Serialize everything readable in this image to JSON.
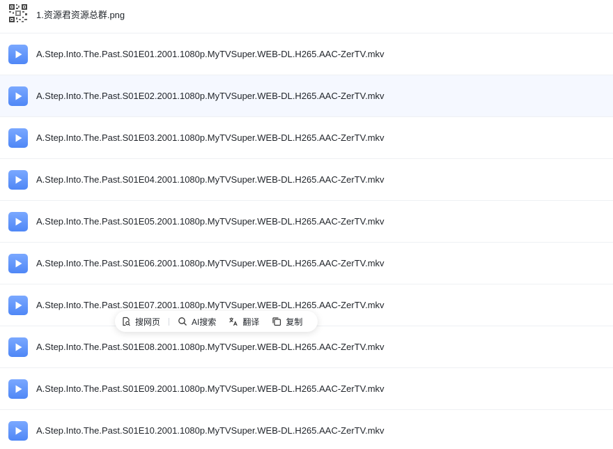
{
  "files": [
    {
      "name": "1.资源君资源总群.png",
      "icon": "qr-code-image-icon"
    },
    {
      "name": "A.Step.Into.The.Past.S01E01.2001.1080p.MyTVSuper.WEB-DL.H265.AAC-ZerTV.mkv",
      "icon": "video-play-icon"
    },
    {
      "name": "A.Step.Into.The.Past.S01E02.2001.1080p.MyTVSuper.WEB-DL.H265.AAC-ZerTV.mkv",
      "icon": "video-play-icon"
    },
    {
      "name": "A.Step.Into.The.Past.S01E03.2001.1080p.MyTVSuper.WEB-DL.H265.AAC-ZerTV.mkv",
      "icon": "video-play-icon"
    },
    {
      "name": "A.Step.Into.The.Past.S01E04.2001.1080p.MyTVSuper.WEB-DL.H265.AAC-ZerTV.mkv",
      "icon": "video-play-icon"
    },
    {
      "name": "A.Step.Into.The.Past.S01E05.2001.1080p.MyTVSuper.WEB-DL.H265.AAC-ZerTV.mkv",
      "icon": "video-play-icon"
    },
    {
      "name": "A.Step.Into.The.Past.S01E06.2001.1080p.MyTVSuper.WEB-DL.H265.AAC-ZerTV.mkv",
      "icon": "video-play-icon"
    },
    {
      "name": "A.Step.Into.The.Past.S01E07.2001.1080p.MyTVSuper.WEB-DL.H265.AAC-ZerTV.mkv",
      "icon": "video-play-icon"
    },
    {
      "name": "A.Step.Into.The.Past.S01E08.2001.1080p.MyTVSuper.WEB-DL.H265.AAC-ZerTV.mkv",
      "icon": "video-play-icon"
    },
    {
      "name": "A.Step.Into.The.Past.S01E09.2001.1080p.MyTVSuper.WEB-DL.H265.AAC-ZerTV.mkv",
      "icon": "video-play-icon"
    },
    {
      "name": "A.Step.Into.The.Past.S01E10.2001.1080p.MyTVSuper.WEB-DL.H265.AAC-ZerTV.mkv",
      "icon": "video-play-icon"
    }
  ],
  "selection_toolbar": {
    "search_web": {
      "label": "搜网页",
      "icon": "web-search-icon"
    },
    "ai_search": {
      "label": "AI搜索",
      "icon": "magnifier-icon"
    },
    "translate": {
      "label": "翻译",
      "icon": "translate-icon"
    },
    "copy": {
      "label": "复制",
      "icon": "copy-icon"
    }
  },
  "colors": {
    "video_icon": "#5b8ff9",
    "hover_row": "#f5f8ff",
    "divider": "#eef0f3",
    "text": "#1f2329"
  }
}
